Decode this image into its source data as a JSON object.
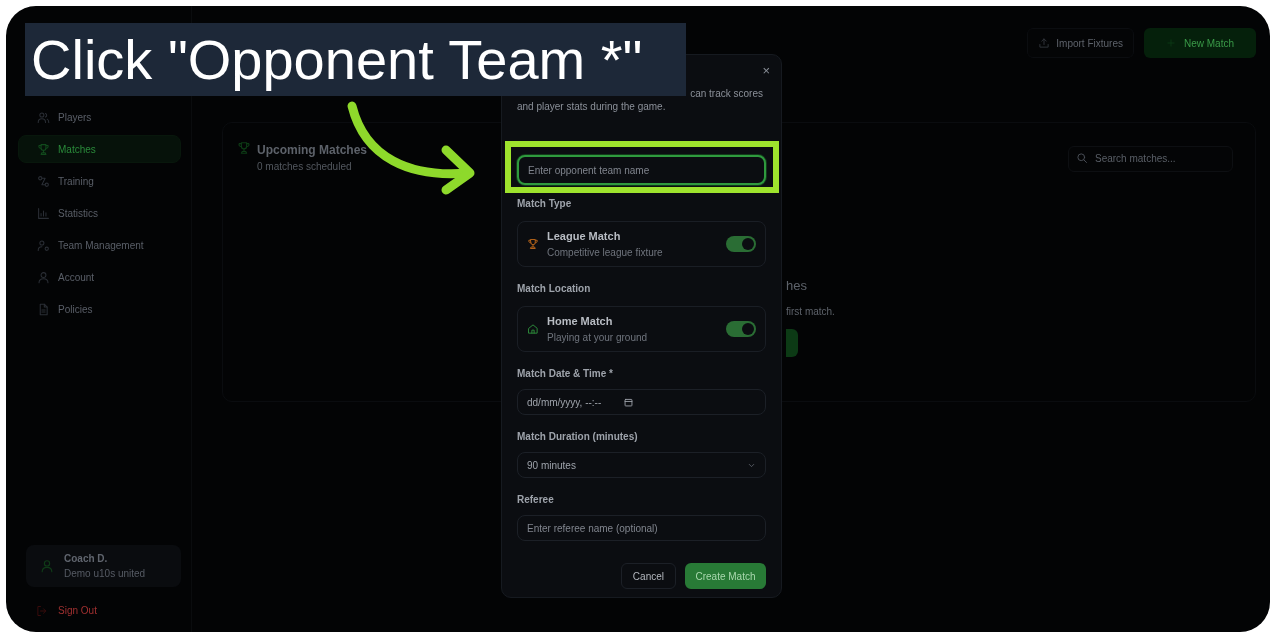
{
  "caption": {
    "text": "Click \"Opponent Team *\""
  },
  "sidebar": {
    "items": [
      {
        "label": "Players",
        "selected": false
      },
      {
        "label": "Matches",
        "selected": true
      },
      {
        "label": "Training",
        "selected": false
      },
      {
        "label": "Statistics",
        "selected": false
      },
      {
        "label": "Team Management",
        "selected": false
      },
      {
        "label": "Account",
        "selected": false
      },
      {
        "label": "Policies",
        "selected": false
      }
    ],
    "user": {
      "name": "Coach D.",
      "team": "Demo u10s united"
    },
    "sign_out": "Sign Out"
  },
  "header": {
    "buttons": [
      {
        "label": "Import Fixtures",
        "kind": "outline"
      },
      {
        "label": "New Match",
        "kind": "primary"
      }
    ]
  },
  "card": {
    "title": "Upcoming Matches",
    "subtitle": "0 matches scheduled",
    "search": {
      "placeholder": "Search matches..."
    }
  },
  "empty_state": {
    "title": "hes",
    "text": "first match."
  },
  "dialog": {
    "close": "×",
    "description": [
      "can track scores",
      "and player stats during the game."
    ],
    "opponent": {
      "placeholder": "Enter opponent team name",
      "focused": true
    },
    "toggles": [
      {
        "label": "Match Type",
        "title": "League Match",
        "subtitle": "Competitive league fixture",
        "kind": "trophy",
        "on": true
      },
      {
        "label": "Match Location",
        "title": "Home Match",
        "subtitle": "Playing at your ground",
        "kind": "home",
        "on": true
      }
    ],
    "date": {
      "label": "Match Date & Time *",
      "value": "dd/mm/yyyy, --:--"
    },
    "duration": {
      "label": "Match Duration (minutes)",
      "value": "90 minutes"
    },
    "referee": {
      "label": "Referee",
      "placeholder": "Enter referee name (optional)"
    },
    "buttons": [
      {
        "label": "Cancel",
        "kind": "secondary"
      },
      {
        "label": "Create Match",
        "kind": "primary"
      }
    ]
  }
}
